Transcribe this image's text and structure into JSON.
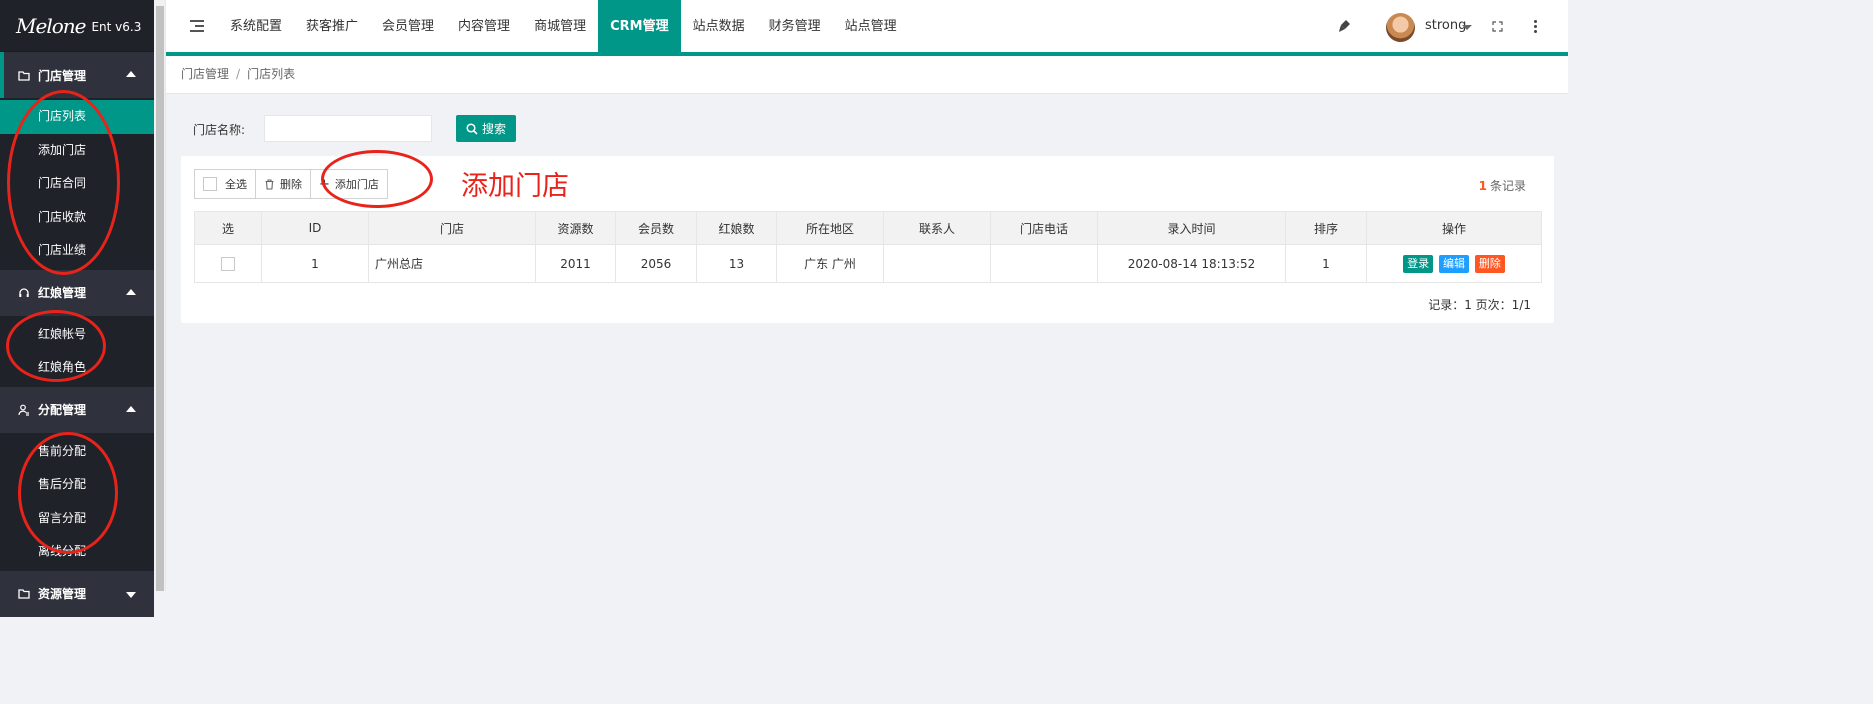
{
  "sidebar": {
    "logo_text": "Melone",
    "logo_version": "Ent v6.3",
    "groups": [
      {
        "label": "门店管理",
        "icon": "folder-icon",
        "expanded": true,
        "items": [
          "门店列表",
          "添加门店",
          "门店合同",
          "门店收款",
          "门店业绩"
        ]
      },
      {
        "label": "红娘管理",
        "icon": "headset-icon",
        "expanded": true,
        "items": [
          "红娘帐号",
          "红娘角色"
        ]
      },
      {
        "label": "分配管理",
        "icon": "user-assign-icon",
        "expanded": true,
        "items": [
          "售前分配",
          "售后分配",
          "留言分配",
          "离线分配"
        ]
      },
      {
        "label": "资源管理",
        "icon": "folder-icon",
        "expanded": false,
        "items": []
      }
    ],
    "active_item": "门店列表"
  },
  "topbar": {
    "nav": [
      "系统配置",
      "获客推广",
      "会员管理",
      "内容管理",
      "商城管理",
      "CRM管理",
      "站点数据",
      "财务管理",
      "站点管理"
    ],
    "active_nav": "CRM管理",
    "username": "strong"
  },
  "breadcrumb": [
    "门店管理",
    "门店列表"
  ],
  "search": {
    "label": "门店名称:",
    "value": "",
    "button": "搜索"
  },
  "toolbar": {
    "select_all": "全选",
    "delete": "删除",
    "add": "添加门店"
  },
  "record_count": {
    "num": "1",
    "suffix": "条记录"
  },
  "table": {
    "headers": [
      "选",
      "ID",
      "门店",
      "资源数",
      "会员数",
      "红娘数",
      "所在地区",
      "联系人",
      "门店电话",
      "录入时间",
      "排序",
      "操作"
    ],
    "rows": [
      {
        "id": "1",
        "store": "广州总店",
        "resources": "2011",
        "members": "2056",
        "matchmakers": "13",
        "region": "广东 广州",
        "contact": "",
        "phone": "",
        "created": "2020-08-14 18:13:52",
        "sort": "1",
        "actions": [
          "登录",
          "编辑",
          "删除"
        ]
      }
    ]
  },
  "pager": "记录：1  页次：1/1",
  "annotation_text": "添加门店",
  "colors": {
    "accent": "#009688",
    "sidebar": "#20222a",
    "danger": "#ff5722",
    "info": "#1e9fff",
    "annotation": "#e8231a"
  }
}
